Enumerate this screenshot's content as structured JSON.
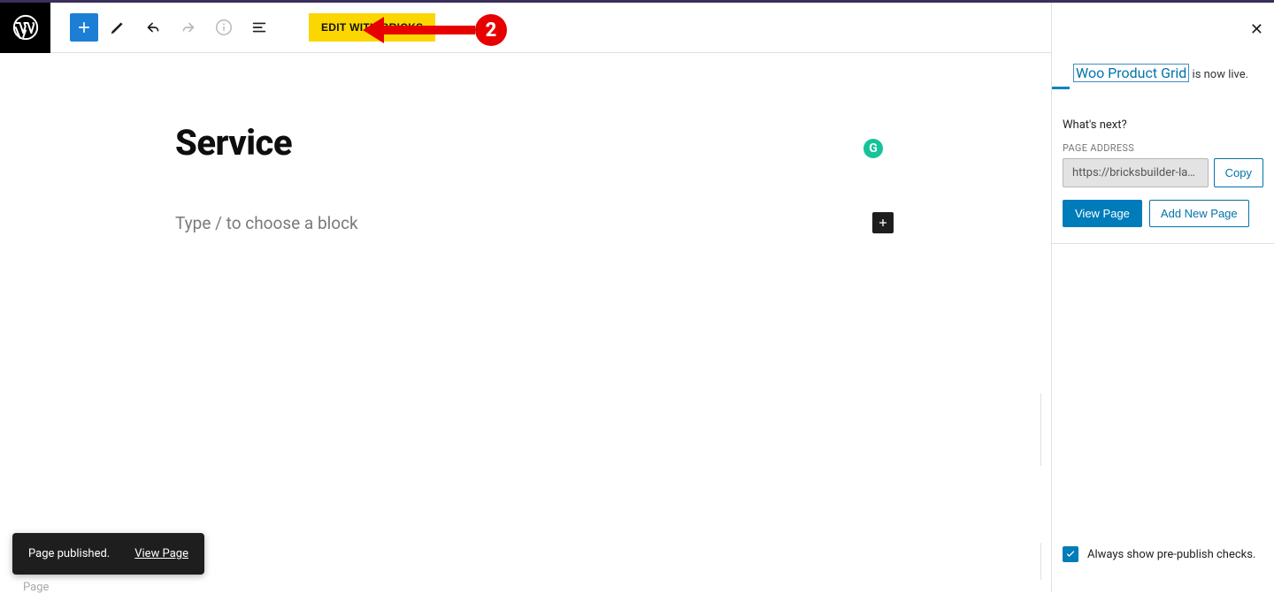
{
  "toolbar": {
    "bricks_label": "EDIT WITH BRICKS"
  },
  "annotation": {
    "number": "2"
  },
  "editor": {
    "title": "Service",
    "block_placeholder": "Type / to choose a block",
    "grammarly_badge": "G"
  },
  "sidebar": {
    "notice_link": "Woo Product Grid",
    "notice_text": " is now live.",
    "whats_next": "What's next?",
    "page_address_label": "PAGE ADDRESS",
    "page_address_value": "https://bricksbuilder-layou...",
    "copy_label": "Copy",
    "view_page_label": "View Page",
    "add_new_page_label": "Add New Page",
    "checkbox_label": "Always show pre-publish checks."
  },
  "toast": {
    "message": "Page published.",
    "link": "View Page"
  },
  "footer": {
    "word": "Page"
  }
}
